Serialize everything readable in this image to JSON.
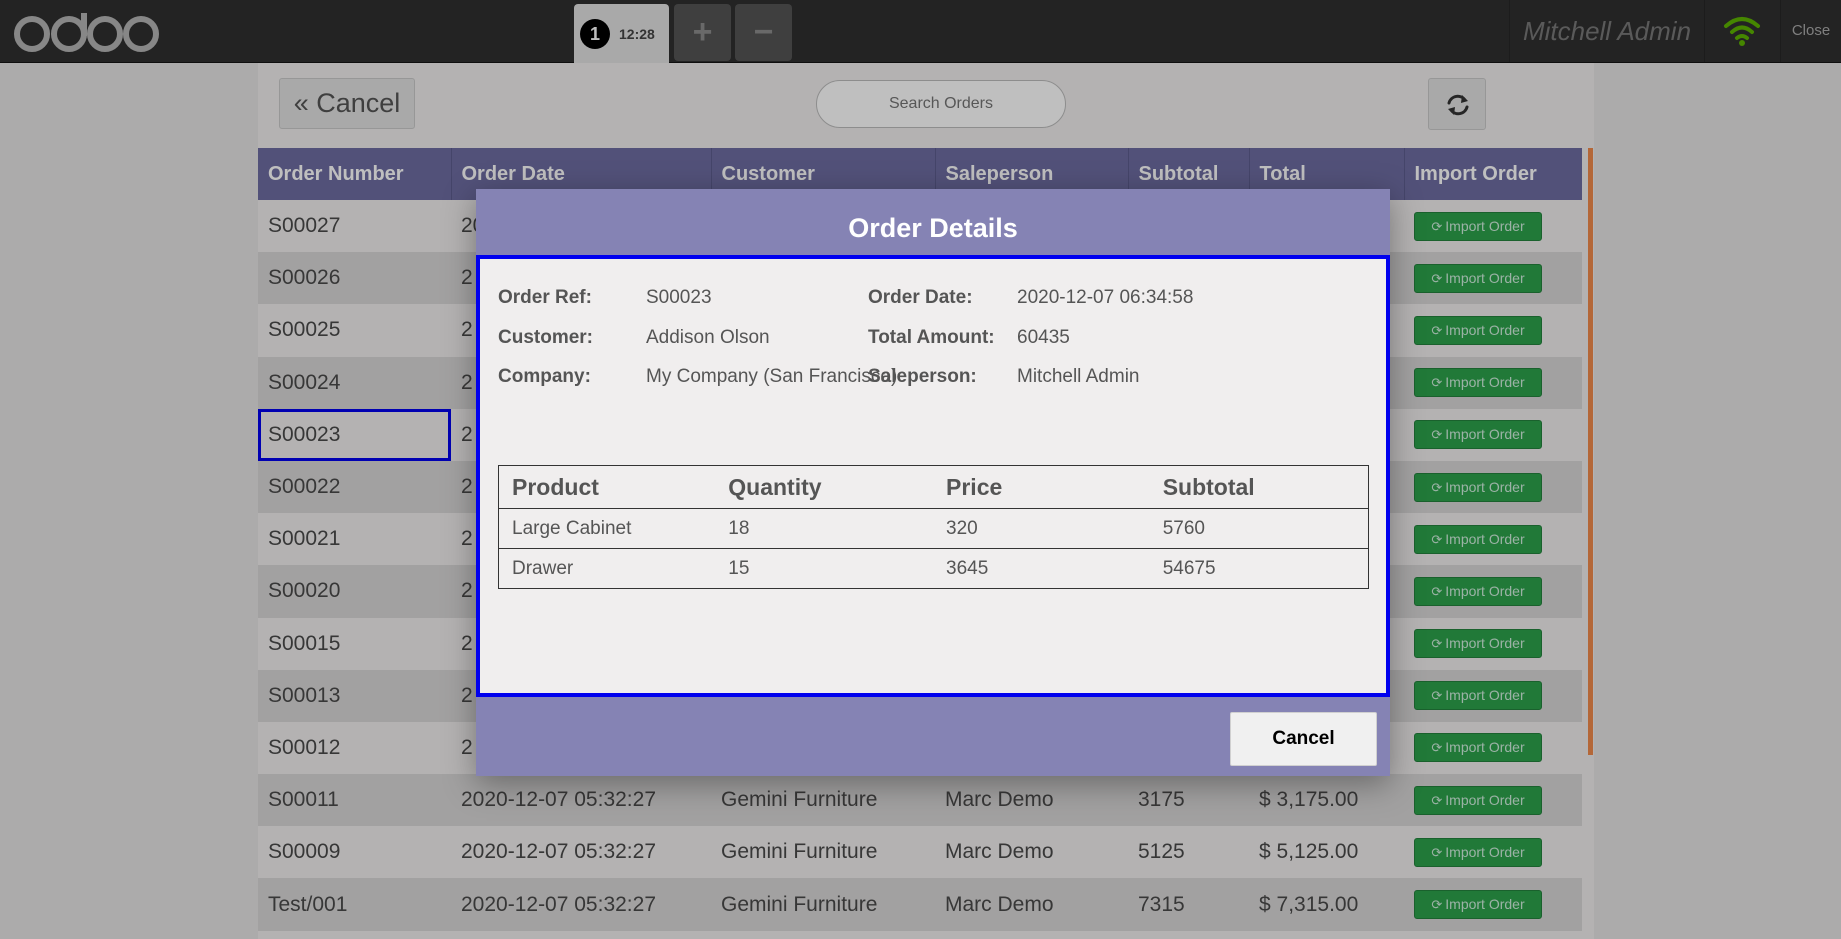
{
  "topbar": {
    "order_tab": {
      "number": "1",
      "time": "12:28"
    },
    "add_order": "+",
    "remove_order": "−",
    "cashier": "Mitchell Admin",
    "close": "Close"
  },
  "toolbar": {
    "cancel_label": "Cancel",
    "search_placeholder": "Search Orders"
  },
  "orders_table": {
    "headers": [
      "Order Number",
      "Order Date",
      "Customer",
      "Saleperson",
      "Subtotal",
      "Total",
      "Import Order"
    ],
    "import_label": "Import Order",
    "rows": [
      {
        "number": "S00027",
        "date": "20",
        "customer": "",
        "saleperson": "",
        "subtotal": "",
        "total": ""
      },
      {
        "number": "S00026",
        "date": "2",
        "customer": "",
        "saleperson": "",
        "subtotal": "",
        "total": ""
      },
      {
        "number": "S00025",
        "date": "2",
        "customer": "",
        "saleperson": "",
        "subtotal": "",
        "total": ""
      },
      {
        "number": "S00024",
        "date": "2",
        "customer": "",
        "saleperson": "",
        "subtotal": "",
        "total": ""
      },
      {
        "number": "S00023",
        "date": "2",
        "customer": "",
        "saleperson": "",
        "subtotal": "",
        "total": ""
      },
      {
        "number": "S00022",
        "date": "2",
        "customer": "",
        "saleperson": "",
        "subtotal": "",
        "total": ""
      },
      {
        "number": "S00021",
        "date": "2",
        "customer": "",
        "saleperson": "",
        "subtotal": "",
        "total": ""
      },
      {
        "number": "S00020",
        "date": "2",
        "customer": "",
        "saleperson": "",
        "subtotal": "",
        "total": ""
      },
      {
        "number": "S00015",
        "date": "2",
        "customer": "",
        "saleperson": "",
        "subtotal": "",
        "total": ""
      },
      {
        "number": "S00013",
        "date": "2",
        "customer": "",
        "saleperson": "",
        "subtotal": "",
        "total": ""
      },
      {
        "number": "S00012",
        "date": "2",
        "customer": "",
        "saleperson": "",
        "subtotal": "",
        "total": ""
      },
      {
        "number": "S00011",
        "date": "2020-12-07 05:32:27",
        "customer": "Gemini Furniture",
        "saleperson": "Marc Demo",
        "subtotal": "3175",
        "total": "$ 3,175.00"
      },
      {
        "number": "S00009",
        "date": "2020-12-07 05:32:27",
        "customer": "Gemini Furniture",
        "saleperson": "Marc Demo",
        "subtotal": "5125",
        "total": "$ 5,125.00"
      },
      {
        "number": "Test/001",
        "date": "2020-12-07 05:32:27",
        "customer": "Gemini Furniture",
        "saleperson": "Marc Demo",
        "subtotal": "7315",
        "total": "$ 7,315.00"
      }
    ]
  },
  "modal": {
    "title": "Order Details",
    "order_ref_label": "Order Ref:",
    "order_ref": "S00023",
    "customer_label": "Customer:",
    "customer": "Addison Olson",
    "company_label": "Company:",
    "company": "My Company (San Francisco)",
    "order_date_label": "Order Date:",
    "order_date": "2020-12-07 06:34:58",
    "total_label": "Total Amount:",
    "total": "60435",
    "saleperson_label": "Saleperson:",
    "saleperson": "Mitchell Admin",
    "line_headers": [
      "Product",
      "Quantity",
      "Price",
      "Subtotal"
    ],
    "lines": [
      {
        "product": "Large Cabinet",
        "quantity": "18",
        "price": "320",
        "subtotal": "5760"
      },
      {
        "product": "Drawer",
        "quantity": "15",
        "price": "3645",
        "subtotal": "54675"
      }
    ],
    "cancel_label": "Cancel"
  },
  "colors": {
    "header_bg": "#6e6da2",
    "modal_bg": "#8583b4",
    "import_green": "#2ca24b",
    "selection_blue": "#0000ee",
    "topbar_bg": "#2f2f2f"
  }
}
